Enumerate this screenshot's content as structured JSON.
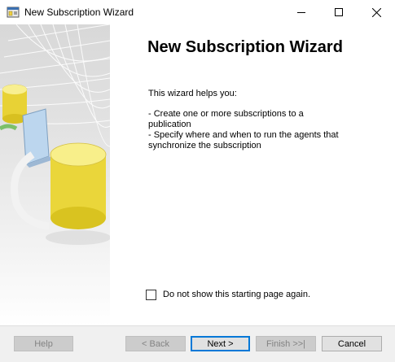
{
  "window": {
    "title": "New Subscription Wizard",
    "icon": "wizard-app-icon",
    "controls": [
      "minimize-icon",
      "maximize-icon",
      "close-icon"
    ]
  },
  "main": {
    "heading": "New Subscription Wizard",
    "intro": "This wizard helps you:",
    "bullets": [
      "- Create one or more subscriptions to a publication",
      "- Specify where and when to run the agents that synchronize the subscription"
    ]
  },
  "checkbox": {
    "label": "Do not show this starting page again.",
    "checked": false
  },
  "buttons": {
    "help": "Help",
    "back": "< Back",
    "next": "Next >",
    "finish": "Finish >>|",
    "cancel": "Cancel"
  },
  "colors": {
    "accent": "#0078d7",
    "cylinder": "#f3e04a",
    "book": "#bcd6ee"
  }
}
